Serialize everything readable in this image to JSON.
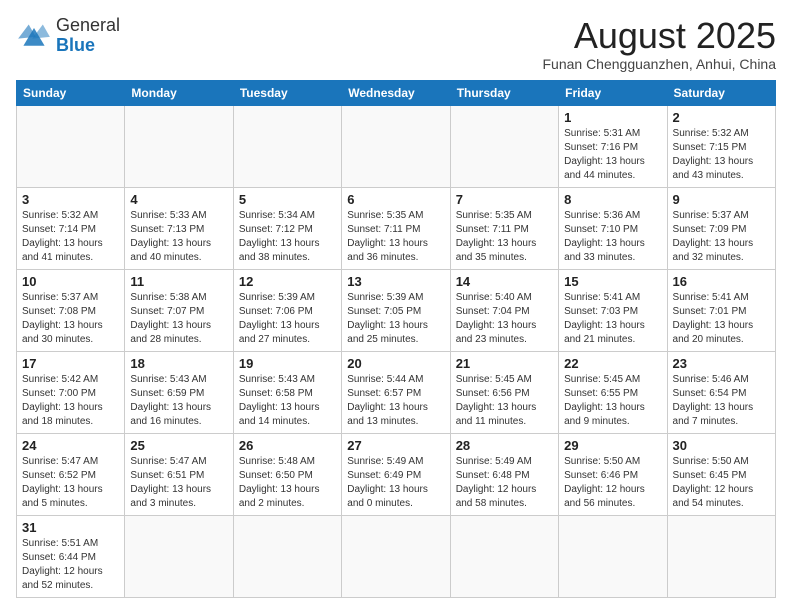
{
  "logo": {
    "general": "General",
    "blue": "Blue"
  },
  "header": {
    "title": "August 2025",
    "subtitle": "Funan Chengguanzhen, Anhui, China"
  },
  "days_of_week": [
    "Sunday",
    "Monday",
    "Tuesday",
    "Wednesday",
    "Thursday",
    "Friday",
    "Saturday"
  ],
  "weeks": [
    [
      {
        "num": "",
        "info": ""
      },
      {
        "num": "",
        "info": ""
      },
      {
        "num": "",
        "info": ""
      },
      {
        "num": "",
        "info": ""
      },
      {
        "num": "",
        "info": ""
      },
      {
        "num": "1",
        "info": "Sunrise: 5:31 AM\nSunset: 7:16 PM\nDaylight: 13 hours and 44 minutes."
      },
      {
        "num": "2",
        "info": "Sunrise: 5:32 AM\nSunset: 7:15 PM\nDaylight: 13 hours and 43 minutes."
      }
    ],
    [
      {
        "num": "3",
        "info": "Sunrise: 5:32 AM\nSunset: 7:14 PM\nDaylight: 13 hours and 41 minutes."
      },
      {
        "num": "4",
        "info": "Sunrise: 5:33 AM\nSunset: 7:13 PM\nDaylight: 13 hours and 40 minutes."
      },
      {
        "num": "5",
        "info": "Sunrise: 5:34 AM\nSunset: 7:12 PM\nDaylight: 13 hours and 38 minutes."
      },
      {
        "num": "6",
        "info": "Sunrise: 5:35 AM\nSunset: 7:11 PM\nDaylight: 13 hours and 36 minutes."
      },
      {
        "num": "7",
        "info": "Sunrise: 5:35 AM\nSunset: 7:11 PM\nDaylight: 13 hours and 35 minutes."
      },
      {
        "num": "8",
        "info": "Sunrise: 5:36 AM\nSunset: 7:10 PM\nDaylight: 13 hours and 33 minutes."
      },
      {
        "num": "9",
        "info": "Sunrise: 5:37 AM\nSunset: 7:09 PM\nDaylight: 13 hours and 32 minutes."
      }
    ],
    [
      {
        "num": "10",
        "info": "Sunrise: 5:37 AM\nSunset: 7:08 PM\nDaylight: 13 hours and 30 minutes."
      },
      {
        "num": "11",
        "info": "Sunrise: 5:38 AM\nSunset: 7:07 PM\nDaylight: 13 hours and 28 minutes."
      },
      {
        "num": "12",
        "info": "Sunrise: 5:39 AM\nSunset: 7:06 PM\nDaylight: 13 hours and 27 minutes."
      },
      {
        "num": "13",
        "info": "Sunrise: 5:39 AM\nSunset: 7:05 PM\nDaylight: 13 hours and 25 minutes."
      },
      {
        "num": "14",
        "info": "Sunrise: 5:40 AM\nSunset: 7:04 PM\nDaylight: 13 hours and 23 minutes."
      },
      {
        "num": "15",
        "info": "Sunrise: 5:41 AM\nSunset: 7:03 PM\nDaylight: 13 hours and 21 minutes."
      },
      {
        "num": "16",
        "info": "Sunrise: 5:41 AM\nSunset: 7:01 PM\nDaylight: 13 hours and 20 minutes."
      }
    ],
    [
      {
        "num": "17",
        "info": "Sunrise: 5:42 AM\nSunset: 7:00 PM\nDaylight: 13 hours and 18 minutes."
      },
      {
        "num": "18",
        "info": "Sunrise: 5:43 AM\nSunset: 6:59 PM\nDaylight: 13 hours and 16 minutes."
      },
      {
        "num": "19",
        "info": "Sunrise: 5:43 AM\nSunset: 6:58 PM\nDaylight: 13 hours and 14 minutes."
      },
      {
        "num": "20",
        "info": "Sunrise: 5:44 AM\nSunset: 6:57 PM\nDaylight: 13 hours and 13 minutes."
      },
      {
        "num": "21",
        "info": "Sunrise: 5:45 AM\nSunset: 6:56 PM\nDaylight: 13 hours and 11 minutes."
      },
      {
        "num": "22",
        "info": "Sunrise: 5:45 AM\nSunset: 6:55 PM\nDaylight: 13 hours and 9 minutes."
      },
      {
        "num": "23",
        "info": "Sunrise: 5:46 AM\nSunset: 6:54 PM\nDaylight: 13 hours and 7 minutes."
      }
    ],
    [
      {
        "num": "24",
        "info": "Sunrise: 5:47 AM\nSunset: 6:52 PM\nDaylight: 13 hours and 5 minutes."
      },
      {
        "num": "25",
        "info": "Sunrise: 5:47 AM\nSunset: 6:51 PM\nDaylight: 13 hours and 3 minutes."
      },
      {
        "num": "26",
        "info": "Sunrise: 5:48 AM\nSunset: 6:50 PM\nDaylight: 13 hours and 2 minutes."
      },
      {
        "num": "27",
        "info": "Sunrise: 5:49 AM\nSunset: 6:49 PM\nDaylight: 13 hours and 0 minutes."
      },
      {
        "num": "28",
        "info": "Sunrise: 5:49 AM\nSunset: 6:48 PM\nDaylight: 12 hours and 58 minutes."
      },
      {
        "num": "29",
        "info": "Sunrise: 5:50 AM\nSunset: 6:46 PM\nDaylight: 12 hours and 56 minutes."
      },
      {
        "num": "30",
        "info": "Sunrise: 5:50 AM\nSunset: 6:45 PM\nDaylight: 12 hours and 54 minutes."
      }
    ],
    [
      {
        "num": "31",
        "info": "Sunrise: 5:51 AM\nSunset: 6:44 PM\nDaylight: 12 hours and 52 minutes."
      },
      {
        "num": "",
        "info": ""
      },
      {
        "num": "",
        "info": ""
      },
      {
        "num": "",
        "info": ""
      },
      {
        "num": "",
        "info": ""
      },
      {
        "num": "",
        "info": ""
      },
      {
        "num": "",
        "info": ""
      }
    ]
  ]
}
